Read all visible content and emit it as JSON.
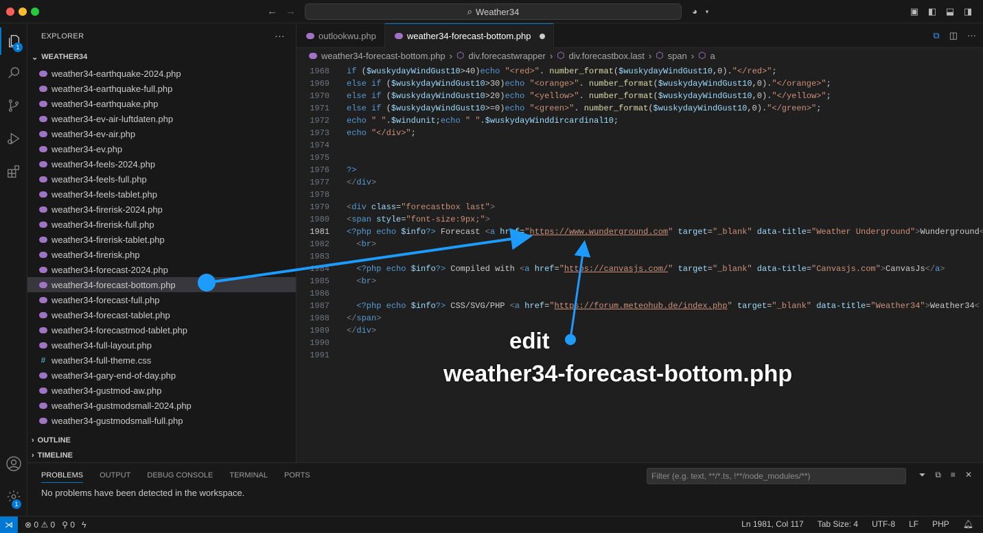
{
  "window": {
    "title": "Weather34"
  },
  "sidebar": {
    "header": "EXPLORER",
    "more": "···",
    "folder": "WEATHER34",
    "files": [
      {
        "name": "weather34-earthquake-2024.php",
        "type": "php"
      },
      {
        "name": "weather34-earthquake-full.php",
        "type": "php"
      },
      {
        "name": "weather34-earthquake.php",
        "type": "php"
      },
      {
        "name": "weather34-ev-air-luftdaten.php",
        "type": "php"
      },
      {
        "name": "weather34-ev-air.php",
        "type": "php"
      },
      {
        "name": "weather34-ev.php",
        "type": "php"
      },
      {
        "name": "weather34-feels-2024.php",
        "type": "php"
      },
      {
        "name": "weather34-feels-full.php",
        "type": "php"
      },
      {
        "name": "weather34-feels-tablet.php",
        "type": "php"
      },
      {
        "name": "weather34-firerisk-2024.php",
        "type": "php"
      },
      {
        "name": "weather34-firerisk-full.php",
        "type": "php"
      },
      {
        "name": "weather34-firerisk-tablet.php",
        "type": "php"
      },
      {
        "name": "weather34-firerisk.php",
        "type": "php"
      },
      {
        "name": "weather34-forecast-2024.php",
        "type": "php"
      },
      {
        "name": "weather34-forecast-bottom.php",
        "type": "php",
        "selected": true
      },
      {
        "name": "weather34-forecast-full.php",
        "type": "php"
      },
      {
        "name": "weather34-forecast-tablet.php",
        "type": "php"
      },
      {
        "name": "weather34-forecastmod-tablet.php",
        "type": "php"
      },
      {
        "name": "weather34-full-layout.php",
        "type": "php"
      },
      {
        "name": "weather34-full-theme.css",
        "type": "css"
      },
      {
        "name": "weather34-gary-end-of-day.php",
        "type": "php"
      },
      {
        "name": "weather34-gustmod-aw.php",
        "type": "php"
      },
      {
        "name": "weather34-gustmodsmall-2024.php",
        "type": "php"
      },
      {
        "name": "weather34-gustmodsmall-full.php",
        "type": "php"
      }
    ],
    "outline": "OUTLINE",
    "timeline": "TIMELINE"
  },
  "activity": {
    "explorer_badge": "1",
    "settings_badge": "1"
  },
  "editor": {
    "tabs": [
      {
        "label": "outlookwu.php",
        "active": false
      },
      {
        "label": "weather34-forecast-bottom.php",
        "active": true,
        "dirty": true
      }
    ],
    "breadcrumbs": [
      "weather34-forecast-bottom.php",
      "div.forecastwrapper",
      "div.forecastbox.last",
      "span",
      "a"
    ],
    "lines": [
      {
        "n": "1968",
        "html": "<span class='k'>if</span> (<span class='v'>$wuskydayWindGust10</span>&gt;40)<span class='k'>echo</span> <span class='s'>\"&lt;red&gt;\"</span>. <span class='f'>number_format</span>(<span class='v'>$wuskydayWindGust10</span>,0).<span class='s'>\"&lt;/red&gt;\"</span>;"
      },
      {
        "n": "1969",
        "html": "<span class='k'>else if</span> (<span class='v'>$wuskydayWindGust10</span>&gt;30)<span class='k'>echo</span> <span class='s'>\"&lt;orange&gt;\"</span>. <span class='f'>number_format</span>(<span class='v'>$wuskydayWindGust10</span>,0).<span class='s'>\"&lt;/orange&gt;\"</span>;"
      },
      {
        "n": "1970",
        "html": "<span class='k'>else if</span> (<span class='v'>$wuskydayWindGust10</span>&gt;20)<span class='k'>echo</span> <span class='s'>\"&lt;yellow&gt;\"</span>. <span class='f'>number_format</span>(<span class='v'>$wuskydayWindGust10</span>,0).<span class='s'>\"&lt;/yellow&gt;\"</span>;"
      },
      {
        "n": "1971",
        "html": "<span class='k'>else if</span> (<span class='v'>$wuskydayWindGust10</span>&gt;=0)<span class='k'>echo</span> <span class='s'>\"&lt;green&gt;\"</span>. <span class='f'>number_format</span>(<span class='v'>$wuskydayWindGust10</span>,0).<span class='s'>\"&lt;/green&gt;\"</span>;"
      },
      {
        "n": "1972",
        "html": "<span class='k'>echo</span> <span class='s'>\" \"</span>.<span class='v'>$windunit</span>;<span class='k'>echo</span> <span class='s'>\" \"</span>.<span class='v'>$wuskydayWinddircardinal10</span>;"
      },
      {
        "n": "1973",
        "html": "<span class='k'>echo</span> <span class='s'>\"&lt;/div&gt;\"</span>;"
      },
      {
        "n": "1974",
        "html": ""
      },
      {
        "n": "1975",
        "html": ""
      },
      {
        "n": "1976",
        "html": "<span class='k'>?&gt;</span>"
      },
      {
        "n": "1977",
        "html": "<span class='t'>&lt;/</span><span class='tag'>div</span><span class='t'>&gt;</span>"
      },
      {
        "n": "1978",
        "html": ""
      },
      {
        "n": "1979",
        "html": "<span class='t'>&lt;</span><span class='tag'>div</span> <span class='attr'>class</span>=<span class='s'>\"forecastbox last\"</span><span class='t'>&gt;</span>"
      },
      {
        "n": "1980",
        "html": "<span class='t'>&lt;</span><span class='tag'>span</span> <span class='attr'>style</span>=<span class='s'>\"font-size:9px;\"</span><span class='t'>&gt;</span>"
      },
      {
        "n": "1981",
        "cur": true,
        "html": "<span class='k'>&lt;?php</span> <span class='k'>echo</span> <span class='v'>$info</span><span class='k'>?&gt;</span> Forecast <span class='t'>&lt;</span><span class='tag'>a</span> <span class='attr'>href</span>=<span class='s'>\"</span><span class='u'>https://www.wunderground.com</span><span class='s'>\"</span> <span class='attr'>target</span>=<span class='s'>\"_blank\"</span> <span class='attr'>data-title</span>=<span class='s'>\"Weather Underground\"</span><span class='t'>&gt;</span>Wunderground<span class='t'>&lt;</span>"
      },
      {
        "n": "1982",
        "html": "  <span class='t'>&lt;</span><span class='tag'>br</span><span class='t'>&gt;</span>"
      },
      {
        "n": "1983",
        "html": ""
      },
      {
        "n": "1984",
        "html": "  <span class='k'>&lt;?php</span> <span class='k'>echo</span> <span class='v'>$info</span><span class='k'>?&gt;</span> Compiled with <span class='t'>&lt;</span><span class='tag'>a</span> <span class='attr'>href</span>=<span class='s'>\"</span><span class='u'>https://canvasjs.com/</span><span class='s'>\"</span> <span class='attr'>target</span>=<span class='s'>\"_blank\"</span> <span class='attr'>data-title</span>=<span class='s'>\"Canvasjs.com\"</span><span class='t'>&gt;</span>CanvasJs<span class='t'>&lt;/</span><span class='tag'>a</span><span class='t'>&gt;</span>"
      },
      {
        "n": "1985",
        "html": "  <span class='t'>&lt;</span><span class='tag'>br</span><span class='t'>&gt;</span>"
      },
      {
        "n": "1986",
        "html": ""
      },
      {
        "n": "1987",
        "html": "  <span class='k'>&lt;?php</span> <span class='k'>echo</span> <span class='v'>$info</span><span class='k'>?&gt;</span> CSS/SVG/PHP <span class='t'>&lt;</span><span class='tag'>a</span> <span class='attr'>href</span>=<span class='s'>\"</span><span class='u'>https://forum.meteohub.de/index.php</span><span class='s'>\"</span> <span class='attr'>target</span>=<span class='s'>\"_blank\"</span> <span class='attr'>data-title</span>=<span class='s'>\"Weather34\"</span><span class='t'>&gt;</span>Weather34<span class='t'>&lt;</span>"
      },
      {
        "n": "1988",
        "html": "<span class='t'>&lt;/</span><span class='tag'>span</span><span class='t'>&gt;</span>"
      },
      {
        "n": "1989",
        "html": "<span class='t'>&lt;/</span><span class='tag'>div</span><span class='t'>&gt;</span>"
      },
      {
        "n": "1990",
        "html": ""
      },
      {
        "n": "1991",
        "html": ""
      }
    ]
  },
  "panel": {
    "tabs": [
      "PROBLEMS",
      "OUTPUT",
      "DEBUG CONSOLE",
      "TERMINAL",
      "PORTS"
    ],
    "filter_placeholder": "Filter (e.g. text, **/*.ts, !**/node_modules/**)",
    "message": "No problems have been detected in the workspace."
  },
  "status": {
    "errors": "0",
    "warnings": "0",
    "ports": "0",
    "position": "Ln 1981, Col 117",
    "tab_size": "Tab Size: 4",
    "encoding": "UTF-8",
    "eol": "LF",
    "language": "PHP"
  },
  "annotation": {
    "line1": "edit",
    "line2": "weather34-forecast-bottom.php",
    "color": "#1e9bff"
  }
}
